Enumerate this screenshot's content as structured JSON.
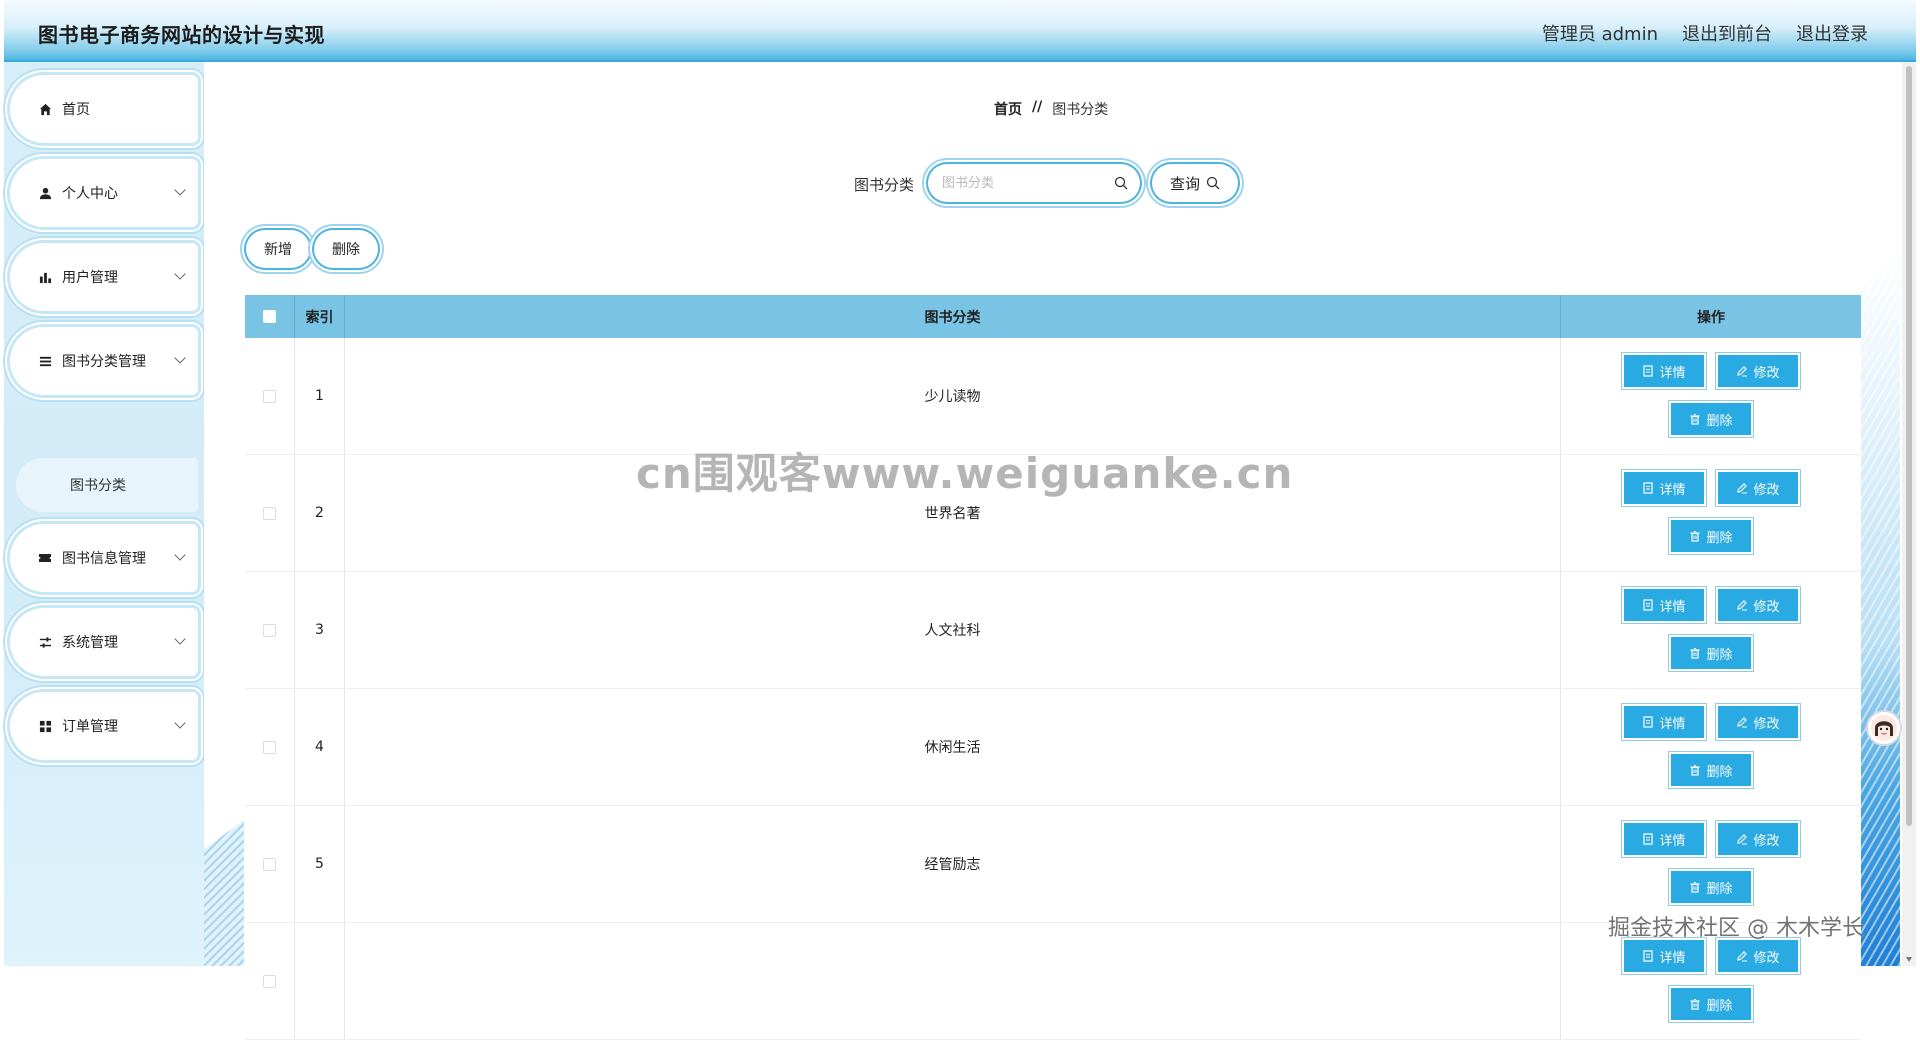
{
  "header": {
    "title": "图书电子商务网站的设计与实现",
    "nav": [
      "管理员 admin",
      "退出到前台",
      "退出登录"
    ]
  },
  "sidebar": {
    "items": [
      {
        "label": "首页",
        "icon": "home-icon"
      },
      {
        "label": "个人中心",
        "icon": "user-icon"
      },
      {
        "label": "用户管理",
        "icon": "bar-chart-icon"
      },
      {
        "label": "图书分类管理",
        "icon": "list-icon"
      },
      {
        "label": "图书信息管理",
        "icon": "ticket-icon"
      },
      {
        "label": "系统管理",
        "icon": "sliders-icon"
      },
      {
        "label": "订单管理",
        "icon": "grid-icon"
      }
    ],
    "subitem": "图书分类"
  },
  "breadcrumb": {
    "home": "首页",
    "sep": "//",
    "current": "图书分类"
  },
  "search": {
    "label": "图书分类",
    "placeholder": "图书分类",
    "value": "",
    "button": "查询"
  },
  "actions": {
    "add": "新增",
    "delete": "删除"
  },
  "table": {
    "headers": {
      "index": "索引",
      "name": "图书分类",
      "ops": "操作"
    },
    "rows": [
      {
        "index": "1",
        "name": "少儿读物"
      },
      {
        "index": "2",
        "name": "世界名著"
      },
      {
        "index": "3",
        "name": "人文社科"
      },
      {
        "index": "4",
        "name": "休闲生活"
      },
      {
        "index": "5",
        "name": "经管励志"
      },
      {
        "index": "",
        "name": ""
      }
    ],
    "ops": {
      "detail": "详情",
      "edit": "修改",
      "delete": "删除"
    }
  },
  "watermark": "cn围观客www.weiguanke.cn",
  "credit": "掘金技术社区 @ 木木学长",
  "colors": {
    "accent": "#2aaae2",
    "header_row": "#79c4e4",
    "sidebar_bg": "#d6eef8"
  }
}
